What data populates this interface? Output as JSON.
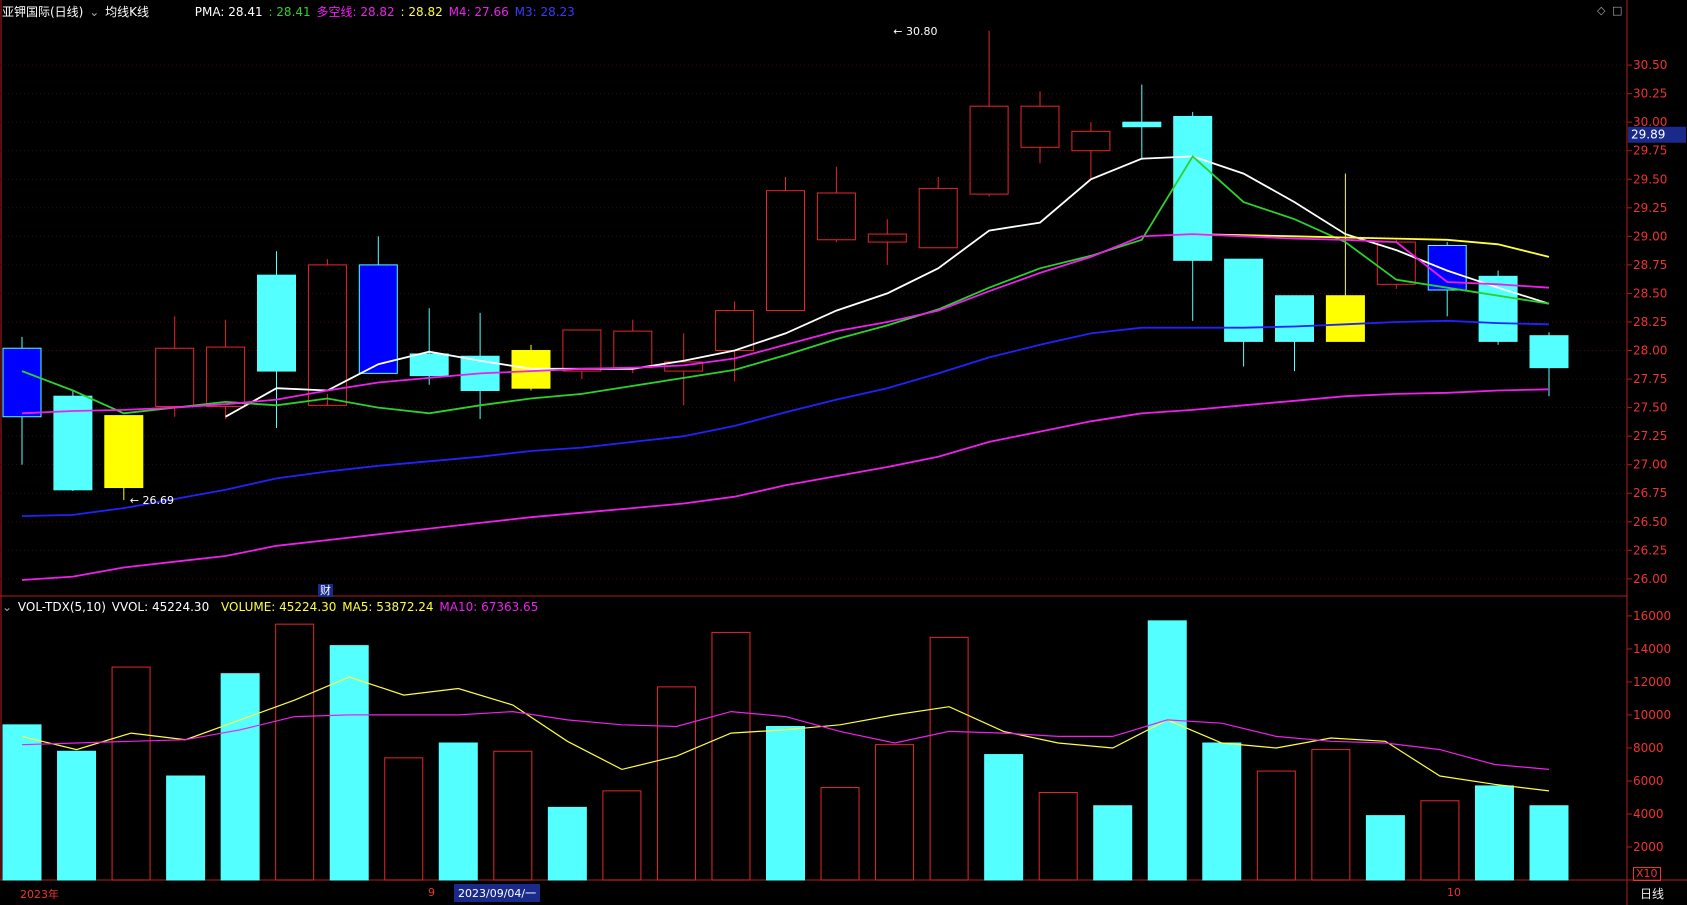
{
  "header": {
    "stock_name": "亚钾国际(日线)",
    "indicator_name": "均线K线",
    "pma_label": "PMA: 28.41",
    "pma2_label": ": 28.41",
    "dkx_label": "多空线: 28.82",
    "dkx2_label": ": 28.82",
    "m4_label": "M4: 27.66",
    "m3_label": "M3: 28.23"
  },
  "volume_header": {
    "indicator_name": "VOL-TDX(5,10)",
    "vvol_label": "VVOL: 45224.30",
    "volume_label": "VOLUME: 45224.30",
    "ma5_label": "MA5: 53872.24",
    "ma10_label": "MA10: 67363.65"
  },
  "controls": {
    "diamond": "◇",
    "square": "□"
  },
  "footer": {
    "year_label": "2023年",
    "month9_label": "9",
    "date_tag": "2023/09/04/一",
    "month10_label": "10",
    "scale_tag": "X10",
    "period_label": "日线"
  },
  "cai_tag": "财",
  "colors": {
    "up": "#e8262b",
    "down": "#54ffff",
    "dkx": "#ffff40",
    "pma": "#ffffff",
    "pma2": "#2cd22c",
    "m4": "#ee20ee",
    "m3": "#2222ff",
    "axis": "#b31b1b",
    "blue_candle": "#0000ff",
    "yellow_candle": "#ffff00"
  },
  "chart_data": [
    {
      "type": "candlestick",
      "y_ticks": [
        30.5,
        30.25,
        30.0,
        29.75,
        29.5,
        29.25,
        29.0,
        28.75,
        28.5,
        28.25,
        28.0,
        27.75,
        27.5,
        27.25,
        27.0,
        26.75,
        26.5,
        26.25,
        26.0
      ],
      "ylim": [
        25.85,
        31.0
      ],
      "current_price": 29.89,
      "annotations": [
        {
          "label": "30.80",
          "index": 17,
          "value": 30.8,
          "side": "right"
        },
        {
          "label": "26.69",
          "index": 2,
          "value": 26.69,
          "side": "right"
        }
      ],
      "candles": [
        {
          "o": 27.42,
          "h": 28.12,
          "l": 27.0,
          "c": 28.02,
          "style": "blue"
        },
        {
          "o": 27.6,
          "h": 27.65,
          "l": 26.77,
          "c": 26.78,
          "style": "down"
        },
        {
          "o": 27.43,
          "h": 27.43,
          "l": 26.69,
          "c": 26.8,
          "style": "yellow"
        },
        {
          "o": 27.51,
          "h": 28.3,
          "l": 27.42,
          "c": 28.02,
          "style": "up"
        },
        {
          "o": 27.51,
          "h": 28.27,
          "l": 27.4,
          "c": 28.03,
          "style": "up"
        },
        {
          "o": 28.66,
          "h": 28.87,
          "l": 27.32,
          "c": 27.82,
          "style": "down"
        },
        {
          "o": 27.52,
          "h": 28.8,
          "l": 27.62,
          "c": 28.75,
          "style": "up"
        },
        {
          "o": 28.75,
          "h": 29.0,
          "l": 27.8,
          "c": 27.8,
          "style": "blue"
        },
        {
          "o": 27.97,
          "h": 28.37,
          "l": 27.7,
          "c": 27.78,
          "style": "down"
        },
        {
          "o": 27.95,
          "h": 28.33,
          "l": 27.4,
          "c": 27.65,
          "style": "down"
        },
        {
          "o": 28.0,
          "h": 28.05,
          "l": 27.65,
          "c": 27.67,
          "style": "yellow"
        },
        {
          "o": 27.82,
          "h": 28.18,
          "l": 27.75,
          "c": 28.18,
          "style": "up"
        },
        {
          "o": 27.85,
          "h": 28.27,
          "l": 27.8,
          "c": 28.17,
          "style": "up"
        },
        {
          "o": 27.82,
          "h": 28.15,
          "l": 27.52,
          "c": 27.9,
          "style": "up"
        },
        {
          "o": 28.0,
          "h": 28.43,
          "l": 27.73,
          "c": 28.35,
          "style": "up"
        },
        {
          "o": 28.35,
          "h": 29.52,
          "l": 28.35,
          "c": 29.4,
          "style": "up"
        },
        {
          "o": 28.97,
          "h": 29.61,
          "l": 28.95,
          "c": 29.38,
          "style": "up"
        },
        {
          "o": 28.95,
          "h": 29.15,
          "l": 28.75,
          "c": 29.02,
          "style": "up"
        },
        {
          "o": 28.9,
          "h": 29.52,
          "l": 28.9,
          "c": 29.42,
          "style": "up"
        },
        {
          "o": 29.37,
          "h": 30.8,
          "l": 29.35,
          "c": 30.14,
          "style": "up"
        },
        {
          "o": 29.78,
          "h": 30.27,
          "l": 29.64,
          "c": 30.14,
          "style": "up"
        },
        {
          "o": 29.75,
          "h": 30.0,
          "l": 29.5,
          "c": 29.92,
          "style": "up"
        },
        {
          "o": 29.96,
          "h": 30.33,
          "l": 29.68,
          "c": 30.0,
          "style": "down"
        },
        {
          "o": 30.05,
          "h": 30.09,
          "l": 28.26,
          "c": 28.79,
          "style": "down"
        },
        {
          "o": 28.8,
          "h": 28.8,
          "l": 27.86,
          "c": 28.08,
          "style": "down"
        },
        {
          "o": 28.48,
          "h": 28.48,
          "l": 27.82,
          "c": 28.08,
          "style": "down"
        },
        {
          "o": 28.48,
          "h": 29.55,
          "l": 28.08,
          "c": 28.08,
          "style": "yellow"
        },
        {
          "o": 28.58,
          "h": 28.97,
          "l": 28.54,
          "c": 28.95,
          "style": "up"
        },
        {
          "o": 28.92,
          "h": 28.95,
          "l": 28.3,
          "c": 28.53,
          "style": "blue"
        },
        {
          "o": 28.65,
          "h": 28.7,
          "l": 28.05,
          "c": 28.08,
          "style": "down"
        },
        {
          "o": 28.13,
          "h": 28.16,
          "l": 27.6,
          "c": 27.85,
          "style": "down"
        }
      ],
      "series": [
        {
          "name": "PMA",
          "color_key": "pma",
          "values": [
            null,
            null,
            null,
            null,
            27.42,
            27.67,
            27.65,
            27.88,
            27.99,
            27.91,
            27.84,
            27.84,
            27.84,
            27.91,
            28.0,
            28.15,
            28.35,
            28.5,
            28.72,
            29.05,
            29.12,
            29.5,
            29.68,
            29.7,
            29.55,
            29.3,
            29.02,
            28.88,
            28.7,
            28.55,
            28.41
          ]
        },
        {
          "name": "PMA2",
          "color_key": "pma2",
          "values": [
            27.82,
            27.65,
            27.45,
            27.5,
            27.55,
            27.52,
            27.58,
            27.5,
            27.45,
            27.52,
            27.58,
            27.62,
            27.69,
            27.76,
            27.83,
            27.96,
            28.1,
            28.22,
            28.36,
            28.55,
            28.72,
            28.83,
            28.97,
            29.7,
            29.3,
            29.15,
            28.95,
            28.62,
            28.55,
            28.48,
            28.41
          ]
        },
        {
          "name": "DKX",
          "color_key": "dkx",
          "values": [
            null,
            null,
            null,
            null,
            null,
            null,
            null,
            null,
            null,
            null,
            null,
            null,
            null,
            null,
            null,
            null,
            null,
            null,
            null,
            null,
            null,
            null,
            null,
            29.02,
            29.01,
            29.0,
            28.99,
            28.98,
            28.97,
            28.93,
            28.82
          ]
        },
        {
          "name": "M4",
          "color_key": "m4",
          "values": [
            27.45,
            27.47,
            27.48,
            27.5,
            27.53,
            27.57,
            27.65,
            27.72,
            27.76,
            27.8,
            27.82,
            27.84,
            27.85,
            27.87,
            27.93,
            28.05,
            28.17,
            28.25,
            28.35,
            28.52,
            28.68,
            28.82,
            29.0,
            29.02,
            29.0,
            28.98,
            28.97,
            28.95,
            28.6,
            28.58,
            28.55
          ]
        },
        {
          "name": "M3",
          "color_key": "m3",
          "values": [
            26.55,
            26.56,
            26.62,
            26.7,
            26.78,
            26.88,
            26.94,
            26.99,
            27.03,
            27.07,
            27.12,
            27.15,
            27.2,
            27.25,
            27.34,
            27.46,
            27.57,
            27.67,
            27.8,
            27.94,
            28.05,
            28.15,
            28.2,
            28.2,
            28.2,
            28.21,
            28.23,
            28.25,
            28.26,
            28.24,
            28.23
          ]
        },
        {
          "name": "M4B",
          "color_key": "m4",
          "values": [
            25.99,
            26.02,
            26.1,
            26.15,
            26.2,
            26.29,
            26.34,
            26.39,
            26.44,
            26.49,
            26.54,
            26.58,
            26.62,
            26.66,
            26.72,
            26.82,
            26.9,
            26.98,
            27.07,
            27.2,
            27.29,
            27.38,
            27.45,
            27.48,
            27.52,
            27.56,
            27.6,
            27.62,
            27.63,
            27.65,
            27.66
          ]
        }
      ]
    },
    {
      "type": "bar",
      "y_ticks": [
        16000,
        14000,
        12000,
        10000,
        8000,
        6000,
        4000,
        2000
      ],
      "ylim": [
        0,
        16600
      ],
      "scale_note": "X10",
      "values": [
        9400,
        7800,
        12900,
        6300,
        12500,
        15500,
        14200,
        7400,
        8300,
        7800,
        4400,
        5400,
        11700,
        15000,
        9300,
        5600,
        8200,
        14700,
        7600,
        5300,
        4500,
        15700,
        8300,
        6600,
        7900,
        3900,
        4800,
        5700,
        4500
      ],
      "styles": [
        "down",
        "down",
        "up",
        "down",
        "down",
        "up",
        "down",
        "up",
        "down",
        "up",
        "down",
        "up",
        "up",
        "up",
        "down",
        "up",
        "up",
        "up",
        "down",
        "up",
        "down",
        "down",
        "down",
        "up",
        "up",
        "down",
        "up",
        "down",
        "down"
      ],
      "series": [
        {
          "name": "MA5",
          "color_key": "dkx",
          "values": [
            8700,
            7900,
            8900,
            8500,
            9700,
            10900,
            12300,
            11200,
            11600,
            10600,
            8400,
            6700,
            7500,
            8900,
            9100,
            9400,
            10000,
            10500,
            9000,
            8300,
            8000,
            9700,
            8300,
            8000,
            8600,
            8400,
            6300,
            5800,
            5400
          ]
        },
        {
          "name": "MA10",
          "color_key": "m4",
          "values": [
            8200,
            8300,
            8400,
            8500,
            9100,
            9900,
            10000,
            10000,
            10000,
            10200,
            9700,
            9400,
            9300,
            10200,
            9900,
            9000,
            8300,
            9000,
            8900,
            8700,
            8700,
            9700,
            9500,
            8700,
            8400,
            8300,
            7900,
            7000,
            6700
          ]
        }
      ]
    }
  ]
}
